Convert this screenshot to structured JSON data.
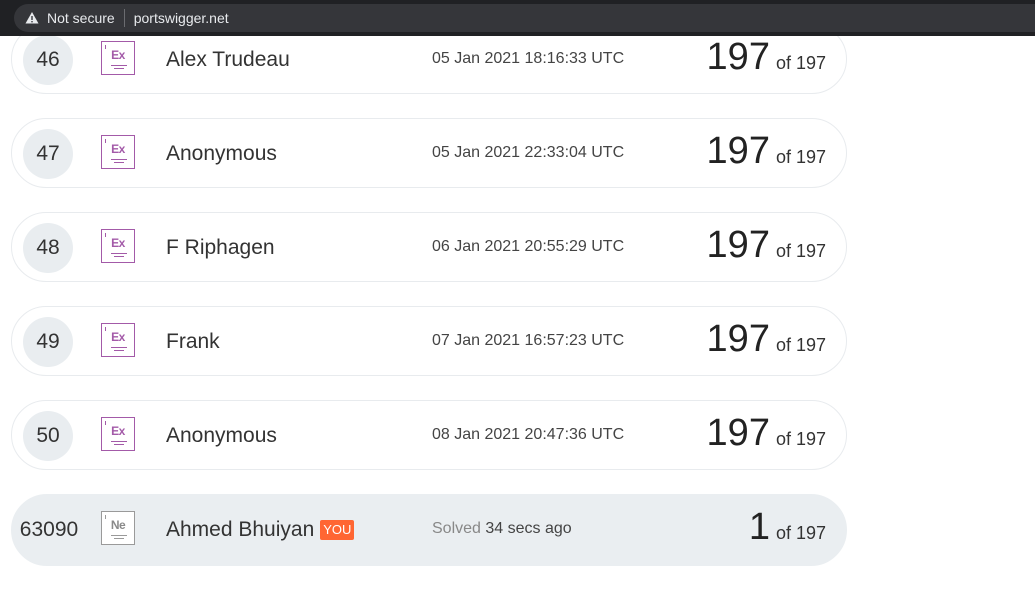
{
  "browser": {
    "security_label": "Not secure",
    "domain": "portswigger.net",
    "warning_icon": "warning-triangle-icon"
  },
  "leaderboard": {
    "rows": [
      {
        "rank": "46",
        "level_icon": "expert-badge-icon",
        "level_code": "Ex",
        "name": "Alex Trudeau",
        "time": "05 Jan 2021 18:16:33 UTC",
        "score": "197",
        "total": "of 197"
      },
      {
        "rank": "47",
        "level_icon": "expert-badge-icon",
        "level_code": "Ex",
        "name": "Anonymous",
        "time": "05 Jan 2021 22:33:04 UTC",
        "score": "197",
        "total": "of 197"
      },
      {
        "rank": "48",
        "level_icon": "expert-badge-icon",
        "level_code": "Ex",
        "name": "F Riphagen",
        "time": "06 Jan 2021 20:55:29 UTC",
        "score": "197",
        "total": "of 197"
      },
      {
        "rank": "49",
        "level_icon": "expert-badge-icon",
        "level_code": "Ex",
        "name": "Frank",
        "time": "07 Jan 2021 16:57:23 UTC",
        "score": "197",
        "total": "of 197"
      },
      {
        "rank": "50",
        "level_icon": "expert-badge-icon",
        "level_code": "Ex",
        "name": "Anonymous",
        "time": "08 Jan 2021 20:47:36 UTC",
        "score": "197",
        "total": "of 197"
      }
    ],
    "current_user": {
      "rank": "63090",
      "level_icon": "novice-badge-icon",
      "level_code": "Ne",
      "name": "Ahmed Bhuiyan",
      "you_tag": "YOU",
      "solved_label": "Solved",
      "solved_ago": "34 secs ago",
      "score": "1",
      "total": "of 197"
    }
  },
  "colors": {
    "expert_badge": "#a35aa8",
    "novice_badge": "#9a9a9a",
    "you_tag": "#ff6633",
    "current_row_bg": "#eaeef1"
  }
}
